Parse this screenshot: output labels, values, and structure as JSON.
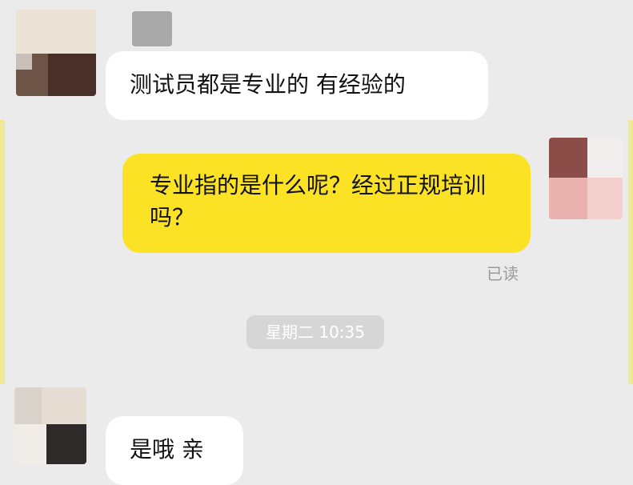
{
  "messages": [
    {
      "direction": "incoming",
      "text": "测试员都是专业的 有经验的"
    },
    {
      "direction": "outgoing",
      "text": "专业指的是什么呢？经过正规培训吗？",
      "status": "已读"
    },
    {
      "direction": "incoming",
      "text": "是哦 亲"
    }
  ],
  "timestamp": "星期二 10:35",
  "colors": {
    "background": "#ebebeb",
    "incoming_bubble": "#ffffff",
    "outgoing_bubble": "#fbe224",
    "timestamp_pill": "#d6d6d6",
    "muted_text": "#9a9a9a"
  },
  "icons": {
    "incoming_avatar": "pixelated-avatar",
    "outgoing_avatar": "pixelated-avatar",
    "top_mark": "pixelated-image"
  }
}
